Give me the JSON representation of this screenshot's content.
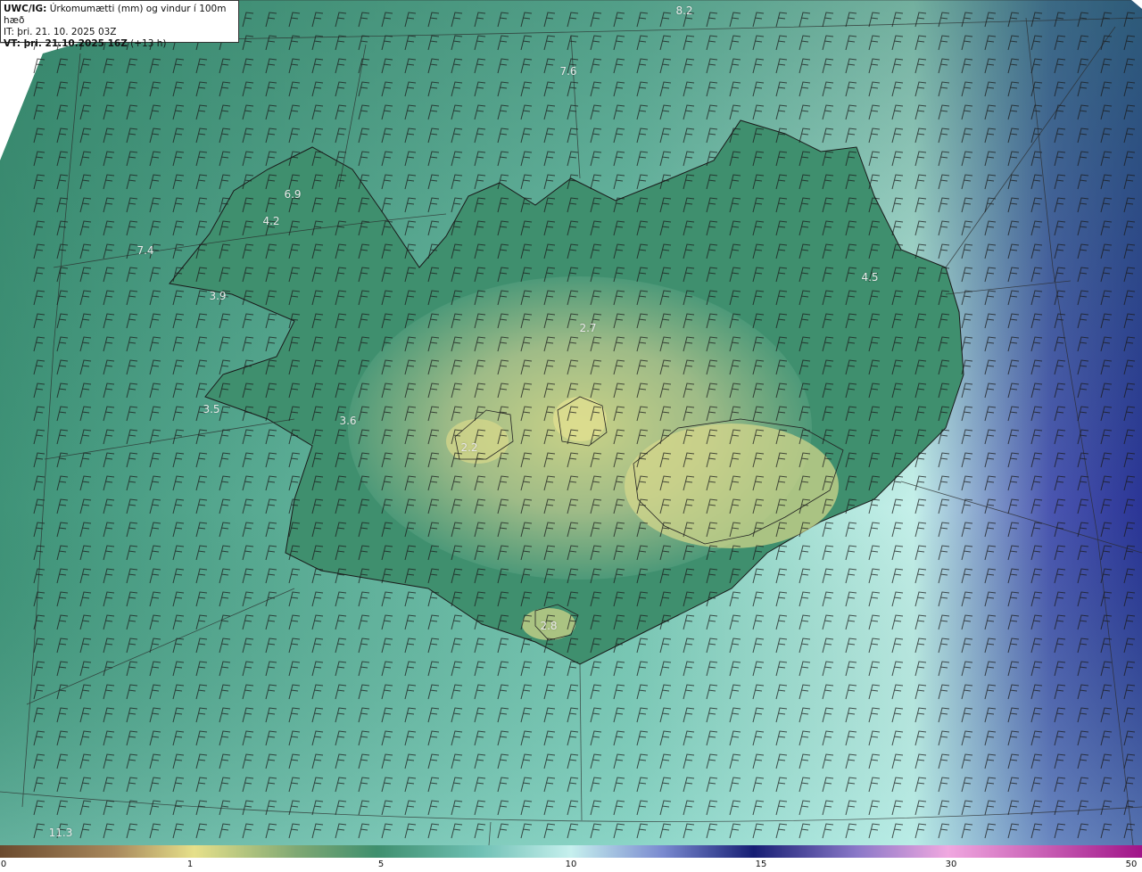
{
  "header": {
    "line1_bold": "UWC/IG:",
    "line1_text": "Úrkomumætti (mm) og vindur í 100m hæð",
    "line2": "IT: þri. 21. 10. 2025 03Z",
    "line3_bold": "VT: þri. 21.10.2025 16Z",
    "line3_text": "(+13 h)"
  },
  "value_labels": [
    "8.2",
    "7.6",
    "6.9",
    "4.2",
    "7.4",
    "3.9",
    "3.5",
    "3.6",
    "2.7",
    "2.2",
    "4.5",
    "2.8",
    "11.3"
  ],
  "colorbar": {
    "ticks": [
      "0",
      "1",
      "5",
      "10",
      "15",
      "30",
      "50"
    ],
    "colors": [
      "#6b4a2e",
      "#a8885c",
      "#e6e08a",
      "#3f8f6e",
      "#6fc0b4",
      "#c6f0ee",
      "#161e74",
      "#f0a8e0",
      "#a01488"
    ]
  }
}
